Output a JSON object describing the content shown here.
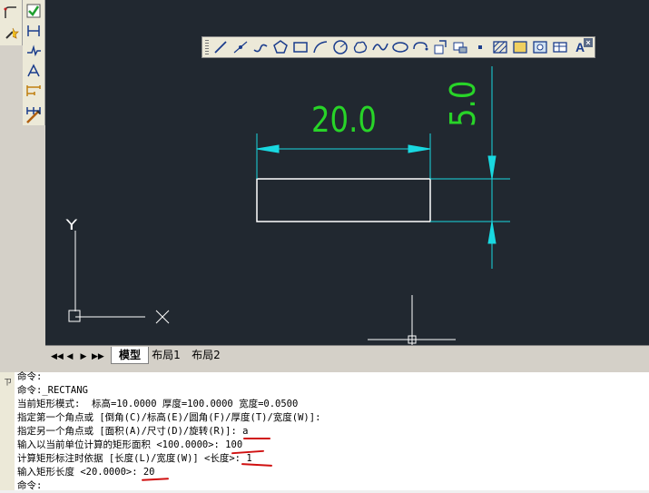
{
  "drawing": {
    "width_dimension_text": "20.0",
    "height_dimension_text": "5.0",
    "ucs_y_label": "Y",
    "ucs_x_marker": "X"
  },
  "tabs": [
    {
      "label": "模型",
      "active": true
    },
    {
      "label": "布局1",
      "active": false
    },
    {
      "label": "布局2",
      "active": false
    }
  ],
  "tab_nav": [
    "◀◀",
    "◀",
    "▶",
    "▶▶"
  ],
  "float_toolbar": {
    "close_label": "×",
    "text_tool_label": "A",
    "tools": [
      "line-icon",
      "construction-line-icon",
      "polyline-icon",
      "polygon-icon",
      "rectangle-icon",
      "arc-icon",
      "circle-icon",
      "revision-cloud-icon",
      "spline-icon",
      "ellipse-icon",
      "ellipse-arc-icon",
      "insert-block-icon",
      "make-block-icon",
      "point-icon",
      "hatch-icon",
      "gradient-icon",
      "region-icon",
      "table-icon",
      "mtext-icon"
    ]
  },
  "command_window": {
    "pin_label": "ㄗ",
    "lines": [
      "命令:",
      "命令:_RECTANG",
      "当前矩形模式:  标高=10.0000 厚度=100.0000 宽度=0.0500",
      "指定第一个角点或 [倒角(C)/标高(E)/圆角(F)/厚度(T)/宽度(W)]:",
      "指定另一个角点或 [面积(A)/尺寸(D)/旋转(R)]: a",
      "输入以当前单位计算的矩形面积 <100.0000>: 100",
      "计算矩形标注时依据 [长度(L)/宽度(W)] <长度>: 1",
      "输入矩形长度 <20.0000>: 20",
      "命令:"
    ]
  },
  "colors": {
    "canvas": "#212830",
    "dimension_lines": "#19d8e0",
    "dimension_text": "#28d428",
    "rectangle": "#ffffff",
    "underline": "#d01010"
  }
}
